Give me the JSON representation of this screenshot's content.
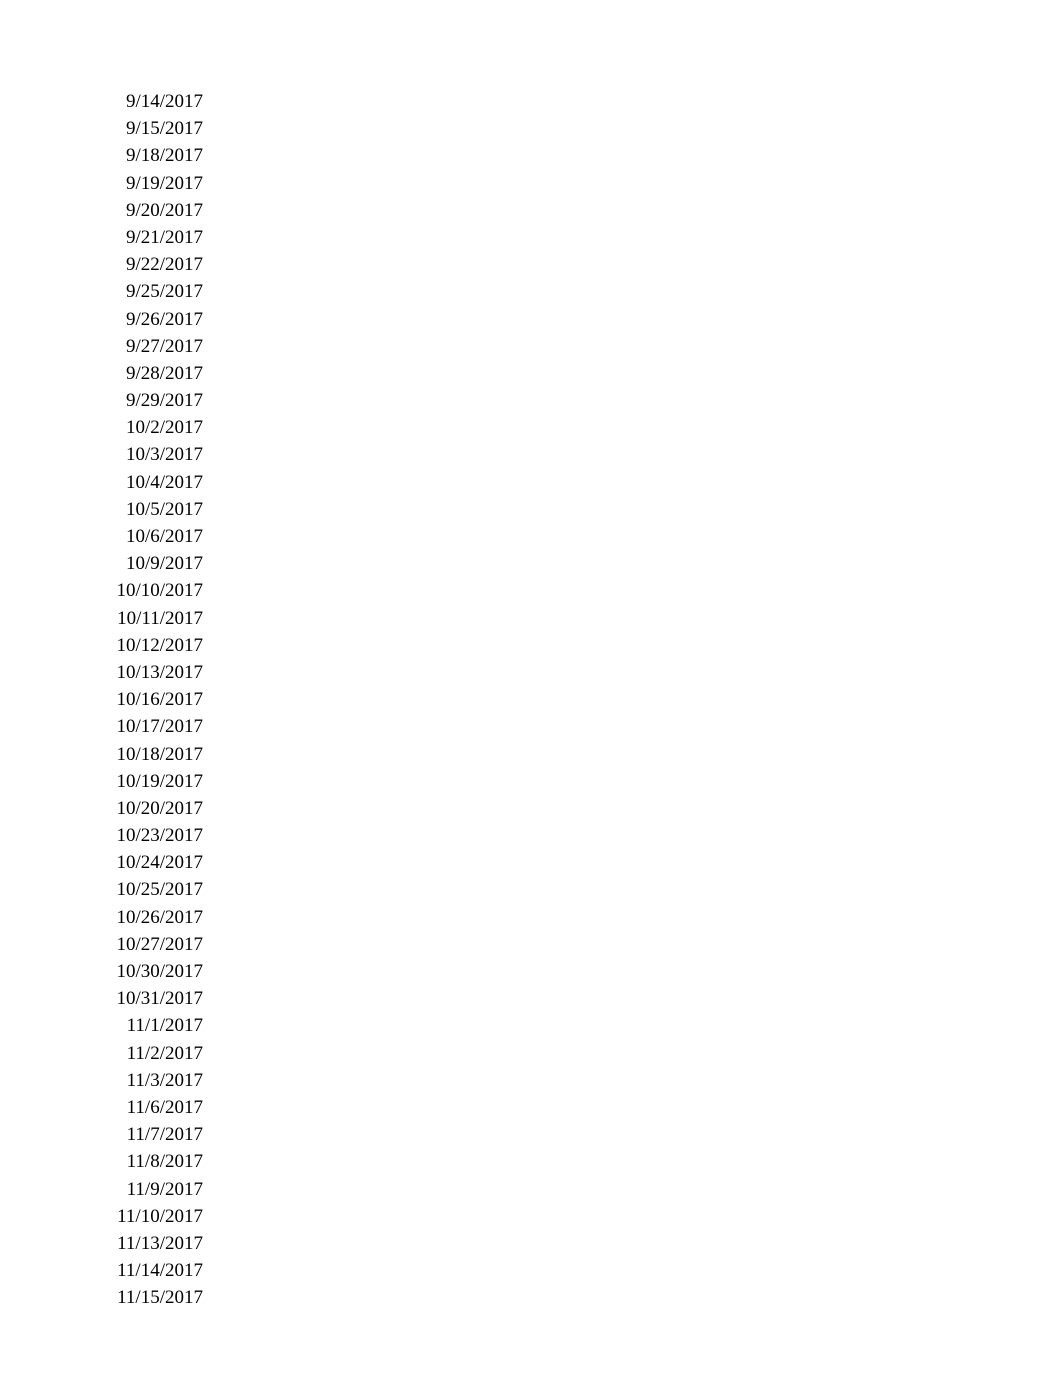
{
  "dates": [
    "9/14/2017",
    "9/15/2017",
    "9/18/2017",
    "9/19/2017",
    "9/20/2017",
    "9/21/2017",
    "9/22/2017",
    "9/25/2017",
    "9/26/2017",
    "9/27/2017",
    "9/28/2017",
    "9/29/2017",
    "10/2/2017",
    "10/3/2017",
    "10/4/2017",
    "10/5/2017",
    "10/6/2017",
    "10/9/2017",
    "10/10/2017",
    "10/11/2017",
    "10/12/2017",
    "10/13/2017",
    "10/16/2017",
    "10/17/2017",
    "10/18/2017",
    "10/19/2017",
    "10/20/2017",
    "10/23/2017",
    "10/24/2017",
    "10/25/2017",
    "10/26/2017",
    "10/27/2017",
    "10/30/2017",
    "10/31/2017",
    "11/1/2017",
    "11/2/2017",
    "11/3/2017",
    "11/6/2017",
    "11/7/2017",
    "11/8/2017",
    "11/9/2017",
    "11/10/2017",
    "11/13/2017",
    "11/14/2017",
    "11/15/2017"
  ]
}
